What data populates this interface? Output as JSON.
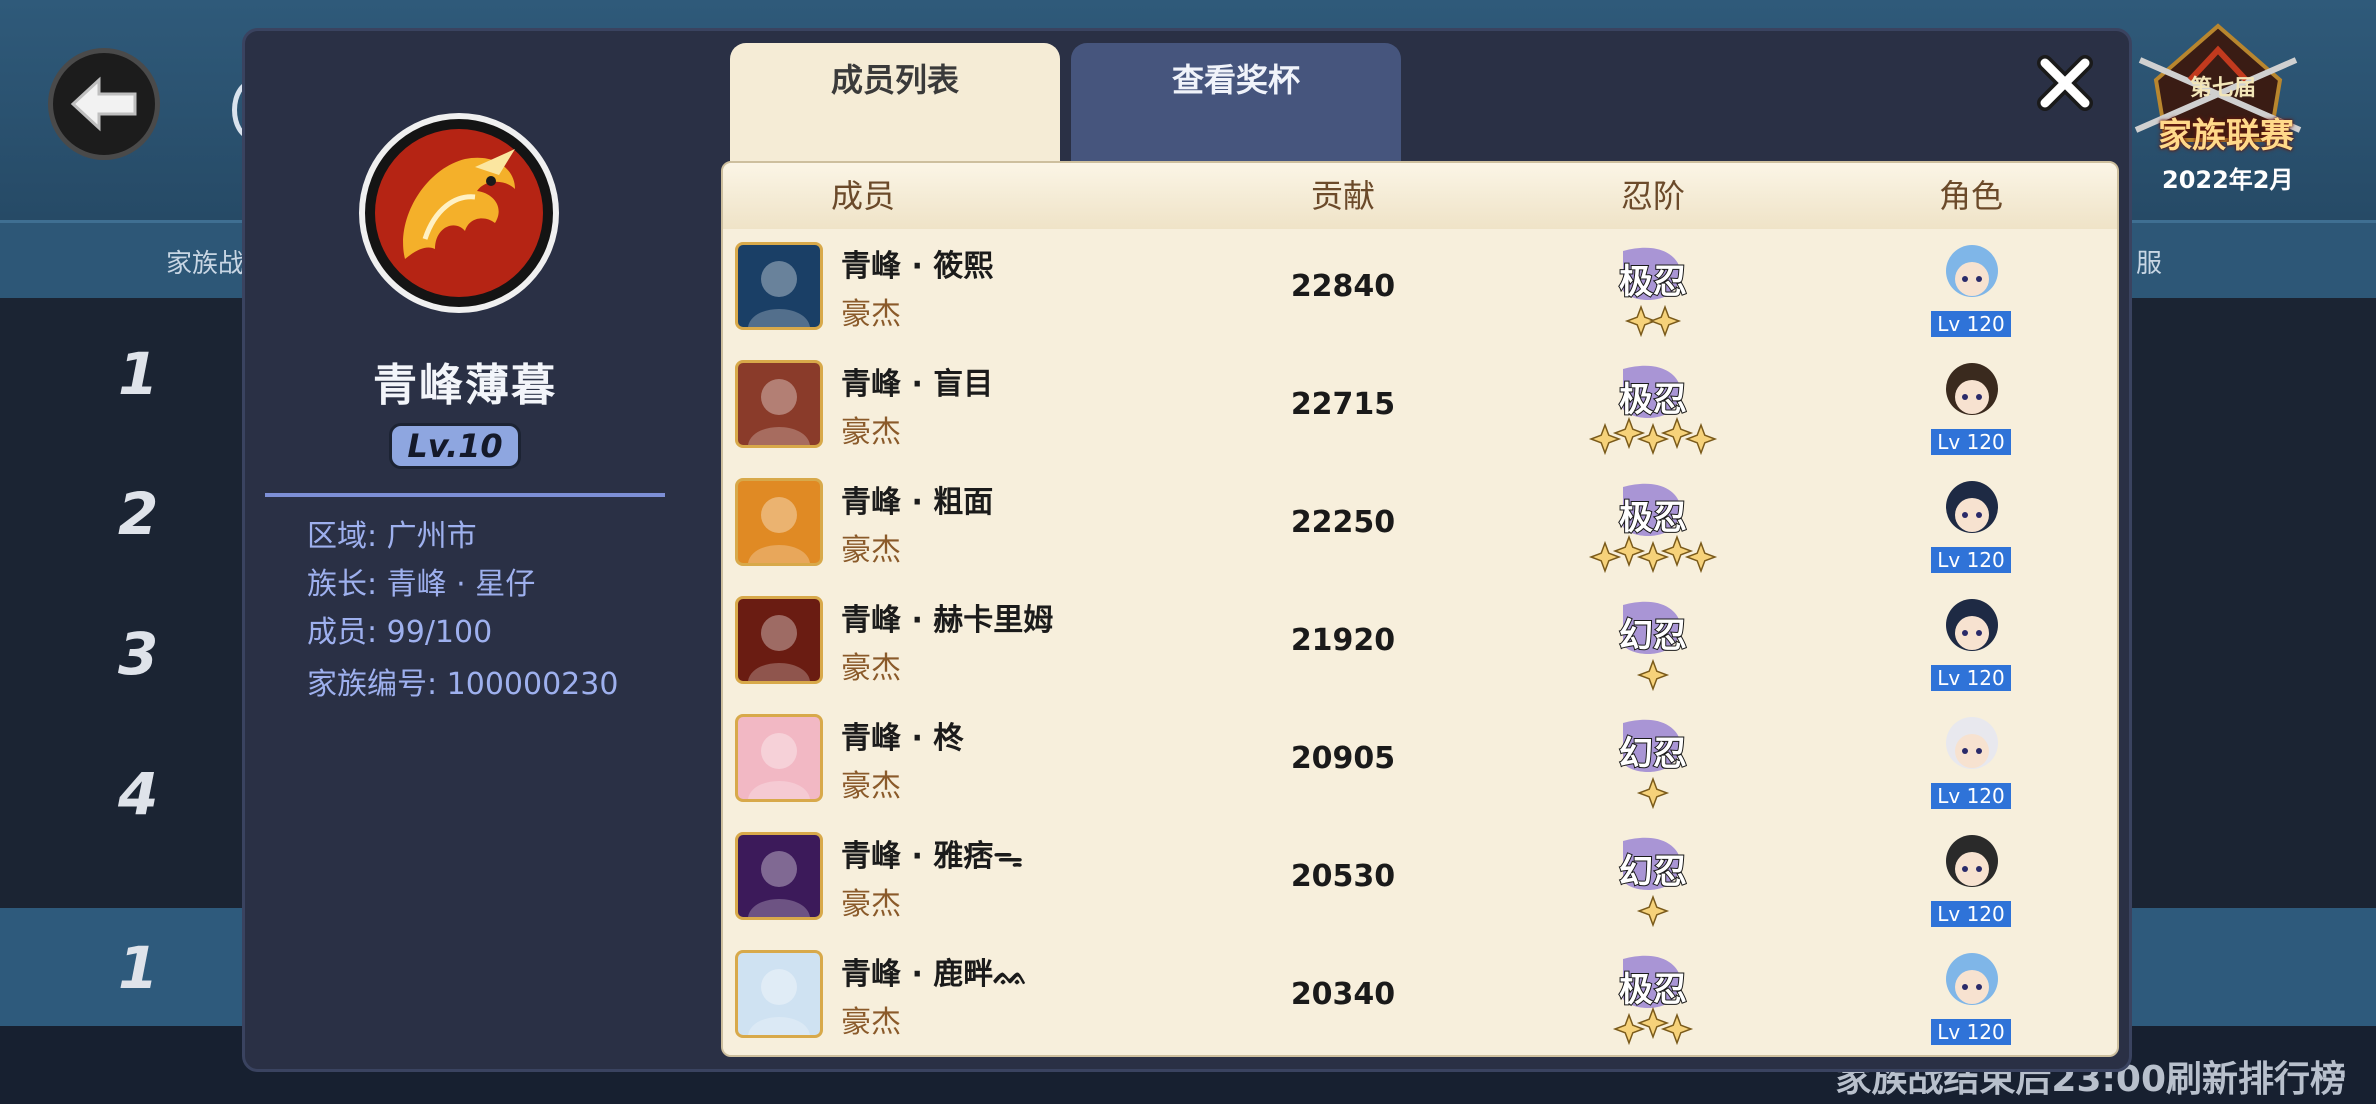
{
  "background": {
    "strip_left": "家族战",
    "strip_right": "服",
    "ranks": [
      "1",
      "2",
      "3",
      "4"
    ],
    "my_rank": "1",
    "refresh_note": "家族战结束后23:00刷新排行榜",
    "event_badge": {
      "edition": "第七届",
      "name": "家族联赛",
      "date": "2022年2月"
    }
  },
  "family": {
    "name": "青峰薄暮",
    "level": "Lv.10",
    "region": "区域: 广州市",
    "leader": "族长: 青峰 · 星仔",
    "members": "成员: 99/100",
    "id": "家族编号: 100000230"
  },
  "tabs": {
    "members": "成员列表",
    "trophies": "查看奖杯"
  },
  "table": {
    "headers": {
      "member": "成员",
      "contribution": "贡献",
      "rank": "忍阶",
      "role": "角色"
    },
    "rows": [
      {
        "name": "青峰 · 筱熙",
        "title": "豪杰",
        "contribution": "22840",
        "rank_label": "极忍",
        "stars": 2,
        "role_level": "Lv 120",
        "avatar_color": "#1a3f66",
        "role_color": "#7fb6e8"
      },
      {
        "name": "青峰 · 盲目",
        "title": "豪杰",
        "contribution": "22715",
        "rank_label": "极忍",
        "stars": 5,
        "role_level": "Lv 120",
        "avatar_color": "#8a3b2a",
        "role_color": "#3a2a1e"
      },
      {
        "name": "青峰 · 粗面",
        "title": "豪杰",
        "contribution": "22250",
        "rank_label": "极忍",
        "stars": 5,
        "role_level": "Lv 120",
        "avatar_color": "#e08a24",
        "role_color": "#1e2a44"
      },
      {
        "name": "青峰 · 赫卡里姆",
        "title": "豪杰",
        "contribution": "21920",
        "rank_label": "幻忍",
        "stars": 1,
        "role_level": "Lv 120",
        "avatar_color": "#6a1c12",
        "role_color": "#1e2a44"
      },
      {
        "name": "青峰 · 柊",
        "title": "豪杰",
        "contribution": "20905",
        "rank_label": "幻忍",
        "stars": 1,
        "role_level": "Lv 120",
        "avatar_color": "#f2b8c4",
        "role_color": "#e8e8ee"
      },
      {
        "name": "青峰 · 雅痞ᯓ",
        "title": "豪杰",
        "contribution": "20530",
        "rank_label": "幻忍",
        "stars": 1,
        "role_level": "Lv 120",
        "avatar_color": "#3c1a5a",
        "role_color": "#2a2a2a"
      },
      {
        "name": "青峰 · 鹿畔ᨐ",
        "title": "豪杰",
        "contribution": "20340",
        "rank_label": "极忍",
        "stars": 3,
        "role_level": "Lv 120",
        "avatar_color": "#cfe2f2",
        "role_color": "#7fb6e8"
      }
    ]
  }
}
